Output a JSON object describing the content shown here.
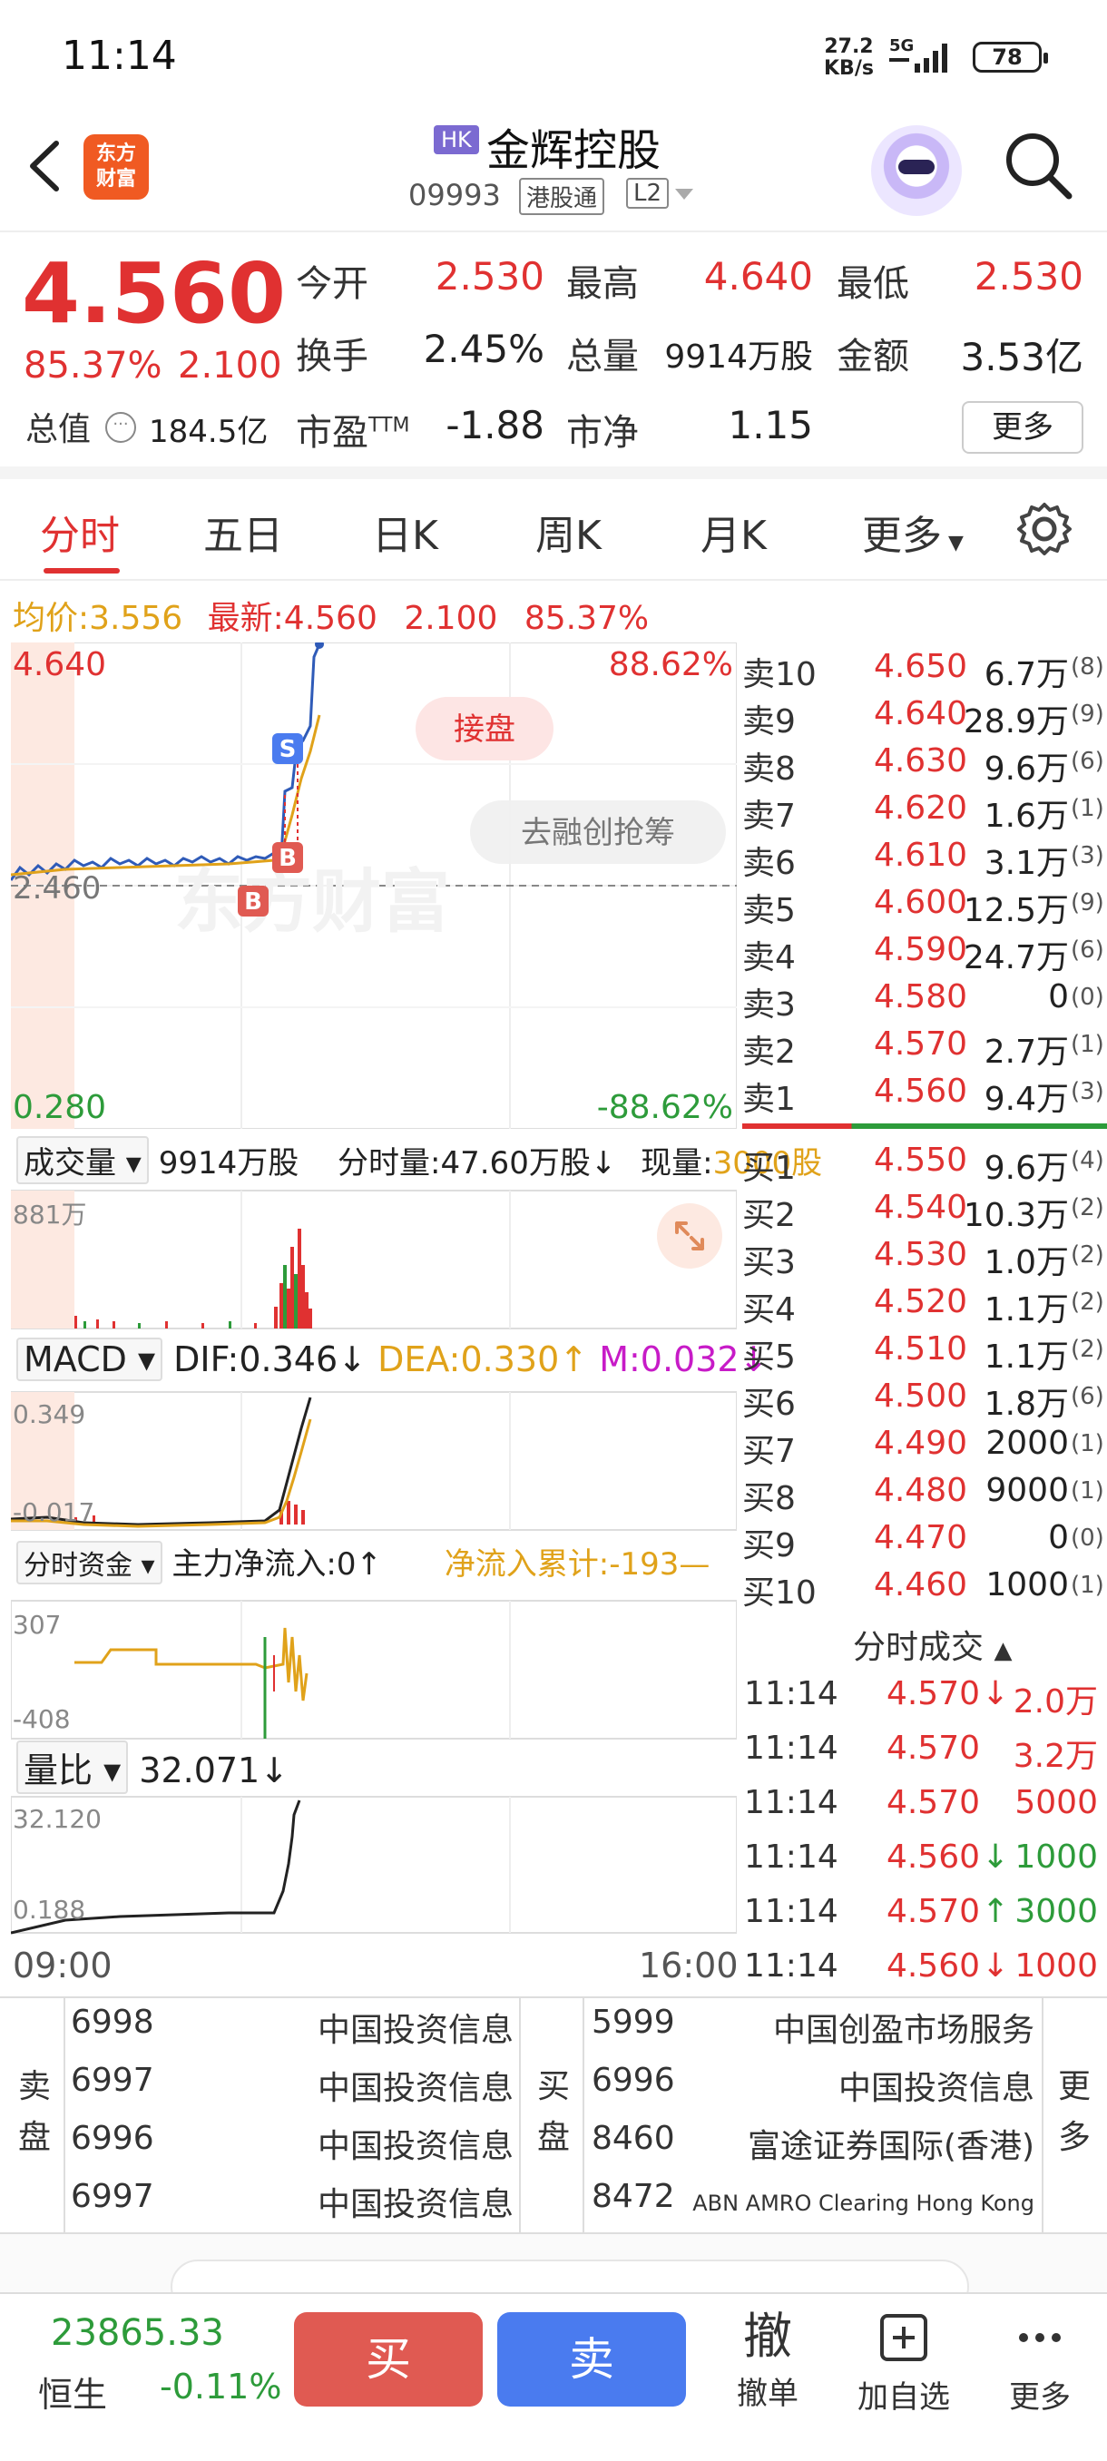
{
  "status": {
    "time": "11:14",
    "netspeed_top": "27.2",
    "netspeed_bottom": "KB/s",
    "network": "5G",
    "battery": "78"
  },
  "header": {
    "logo_line1": "东方",
    "logo_line2": "财富",
    "market_badge": "HK",
    "stock_name": "金辉控股",
    "stock_code": "09993",
    "connect_tag": "港股通",
    "level_tag": "L2"
  },
  "quote": {
    "last": "4.560",
    "change_pct": "85.37%",
    "change_abs": "2.100",
    "open_label": "今开",
    "open": "2.530",
    "high_label": "最高",
    "high": "4.640",
    "low_label": "最低",
    "low": "2.530",
    "turnover_label": "换手",
    "turnover": "2.45%",
    "volume_label": "总量",
    "volume": "9914万股",
    "amount_label": "金额",
    "amount": "3.53亿",
    "mktcap_label": "总值",
    "mktcap": "184.5亿",
    "pe_label": "市盈",
    "pe_sup": "TTM",
    "pe": "-1.88",
    "pb_label": "市净",
    "pb": "1.15",
    "more": "更多"
  },
  "tabs": [
    "分时",
    "五日",
    "日K",
    "周K",
    "月K",
    "更多"
  ],
  "info": {
    "avg_label": "均价:",
    "avg": "3.556",
    "latest_label": "最新:",
    "latest": "4.560",
    "chg": "2.100",
    "pct": "85.37%"
  },
  "main_chart": {
    "y_top": "4.640",
    "y_mid": "2.460",
    "y_bottom": "0.280",
    "pct_top": "88.62%",
    "pct_bottom": "-88.62%",
    "watermark": "东方财富",
    "pill1": "接盘",
    "pill2": "去融创抢筹",
    "marker_s": "S",
    "marker_b": "B"
  },
  "volume_panel": {
    "label": "成交量",
    "total": "9914万股",
    "minute_label": "分时量:47.60万股↓",
    "now_label": "现量:",
    "now_val": "3000股",
    "ymax": "881万"
  },
  "macd_panel": {
    "label": "MACD",
    "dif": "DIF:0.346↓",
    "dea": "DEA:0.330↑",
    "m": "M:0.032↓",
    "ytop": "0.349",
    "ybot": "-0.017"
  },
  "fund_panel": {
    "label": "分时资金",
    "main": "主力净流入:0↑",
    "cum": "净流入累计:-193—",
    "ytop": "307",
    "ybot": "-408"
  },
  "ratio_panel": {
    "label": "量比",
    "val": "32.071↓",
    "ytop": "32.120",
    "ybot": "0.188"
  },
  "axis_time": {
    "start": "09:00",
    "end": "16:00"
  },
  "asks": [
    {
      "label": "卖10",
      "price": "4.650",
      "vol": "6.7万",
      "cnt": "(8)"
    },
    {
      "label": "卖9",
      "price": "4.640",
      "vol": "28.9万",
      "cnt": "(9)"
    },
    {
      "label": "卖8",
      "price": "4.630",
      "vol": "9.6万",
      "cnt": "(6)"
    },
    {
      "label": "卖7",
      "price": "4.620",
      "vol": "1.6万",
      "cnt": "(1)"
    },
    {
      "label": "卖6",
      "price": "4.610",
      "vol": "3.1万",
      "cnt": "(3)"
    },
    {
      "label": "卖5",
      "price": "4.600",
      "vol": "12.5万",
      "cnt": "(9)"
    },
    {
      "label": "卖4",
      "price": "4.590",
      "vol": "24.7万",
      "cnt": "(6)"
    },
    {
      "label": "卖3",
      "price": "4.580",
      "vol": "0",
      "cnt": "(0)"
    },
    {
      "label": "卖2",
      "price": "4.570",
      "vol": "2.7万",
      "cnt": "(1)"
    },
    {
      "label": "卖1",
      "price": "4.560",
      "vol": "9.4万",
      "cnt": "(3)"
    }
  ],
  "bids": [
    {
      "label": "买1",
      "price": "4.550",
      "vol": "9.6万",
      "cnt": "(4)"
    },
    {
      "label": "买2",
      "price": "4.540",
      "vol": "10.3万",
      "cnt": "(2)"
    },
    {
      "label": "买3",
      "price": "4.530",
      "vol": "1.0万",
      "cnt": "(2)"
    },
    {
      "label": "买4",
      "price": "4.520",
      "vol": "1.1万",
      "cnt": "(2)"
    },
    {
      "label": "买5",
      "price": "4.510",
      "vol": "1.1万",
      "cnt": "(2)"
    },
    {
      "label": "买6",
      "price": "4.500",
      "vol": "1.8万",
      "cnt": "(6)"
    },
    {
      "label": "买7",
      "price": "4.490",
      "vol": "2000",
      "cnt": "(1)"
    },
    {
      "label": "买8",
      "price": "4.480",
      "vol": "9000",
      "cnt": "(1)"
    },
    {
      "label": "买9",
      "price": "4.470",
      "vol": "0",
      "cnt": "(0)"
    },
    {
      "label": "买10",
      "price": "4.460",
      "vol": "1000",
      "cnt": "(1)"
    }
  ],
  "ticks_title": "分时成交",
  "ticks": [
    {
      "time": "11:14",
      "price": "4.570",
      "dir": "↓",
      "vol": "2.0万",
      "color": "#e03131"
    },
    {
      "time": "11:14",
      "price": "4.570",
      "dir": "",
      "vol": "3.2万",
      "color": "#e03131"
    },
    {
      "time": "11:14",
      "price": "4.570",
      "dir": "",
      "vol": "5000",
      "color": "#e03131"
    },
    {
      "time": "11:14",
      "price": "4.560",
      "dir": "↓",
      "vol": "1000",
      "color": "#2d9b3a"
    },
    {
      "time": "11:14",
      "price": "4.570",
      "dir": "↑",
      "vol": "3000",
      "color": "#2d9b3a"
    },
    {
      "time": "11:14",
      "price": "4.560",
      "dir": "↓",
      "vol": "1000",
      "color": "#e03131"
    }
  ],
  "broker": {
    "sell_label": "卖盘",
    "buy_label": "买盘",
    "more": "更多",
    "sell": [
      {
        "id": "6998",
        "name": "中国投资信息"
      },
      {
        "id": "6997",
        "name": "中国投资信息"
      },
      {
        "id": "6996",
        "name": "中国投资信息"
      },
      {
        "id": "6997",
        "name": "中国投资信息"
      }
    ],
    "buy": [
      {
        "id": "5999",
        "name": "中国创盈市场服务"
      },
      {
        "id": "6996",
        "name": "中国投资信息"
      },
      {
        "id": "8460",
        "name": "富途证券国际(香港)"
      },
      {
        "id": "8472",
        "name": "ABN AMRO Clearing Hong Kong"
      }
    ]
  },
  "bottom": {
    "index_val": "23865.33",
    "index_name": "恒生",
    "index_chg": "-0.11%",
    "buy": "买",
    "sell": "卖",
    "cancel_icon": "撤",
    "cancel": "撤单",
    "add": "加自选",
    "more": "更多"
  },
  "colors": {
    "up": "#e03131",
    "down": "#2d9b3a",
    "avg": "#e0a21a",
    "accent": "#e03131"
  }
}
